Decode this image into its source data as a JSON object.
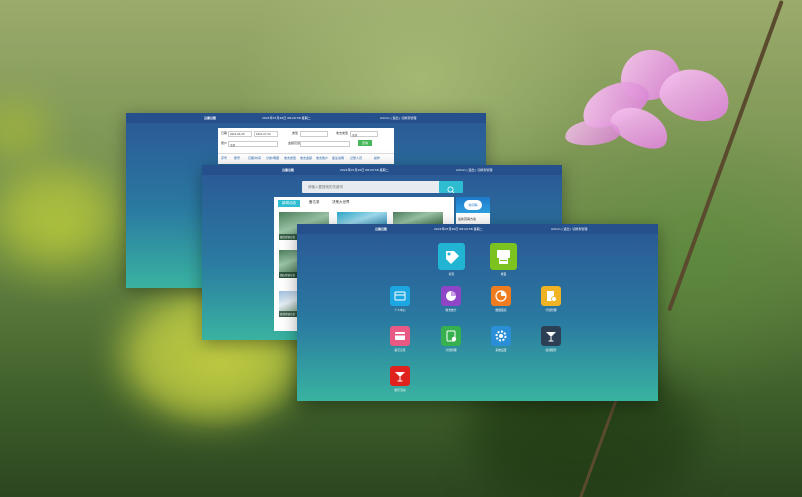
{
  "windows": {
    "w1": {
      "title": "云南记账",
      "datetime": "2021年07月20日 08:20:58 星期二",
      "user_links": "Admin | 退出 | 切换到管理",
      "form": {
        "date_label": "日期",
        "date_from": "2021-06-30",
        "date_to": "2021-07-20",
        "type_label": "类型",
        "category_label": "收支类型",
        "category_value": "全部",
        "account_label": "账户",
        "account_value": "全部",
        "amount_label": "金额范围",
        "query_button": "查询"
      },
      "nav": [
        "序号",
        "账号",
        "日期/时间",
        "分类/明细",
        "收支类型",
        "收支金额",
        "收支账户",
        "备注说明",
        "记账人员",
        "操作"
      ]
    },
    "w2": {
      "title": "云南记账",
      "datetime": "2021年07月20日 08:20:58 星期二",
      "user_links": "Admin | 退出 | 切换到管理",
      "search_placeholder": "请输入要搜索的关键词",
      "tabs": [
        "新闻动态",
        "备忘录",
        "决策大世界"
      ],
      "thumbs": [
        "微信营销方案",
        "",
        "",
        "酒店营销方案",
        "旅游营销方案"
      ],
      "side_badge": "新闻稿",
      "side_text": "最新营销方案"
    },
    "w3": {
      "title": "云南记账",
      "datetime": "2021年07月20日 08:20:58 星期二",
      "user_links": "Admin | 退出 | 切换到管理",
      "apps": [
        {
          "label": "标签",
          "color": "#22b5d3",
          "icon": "tag-icon"
        },
        {
          "label": "收银",
          "color": "#7cc31f",
          "icon": "cashier-icon"
        },
        {
          "label": "个人中心",
          "color": "#1da7e2",
          "icon": "wallet-icon"
        },
        {
          "label": "收支统计",
          "color": "#8e45c6",
          "icon": "pie-chart-icon"
        },
        {
          "label": "数据报表",
          "color": "#ef7c1f",
          "icon": "report-icon"
        },
        {
          "label": "计划管理",
          "color": "#f0b323",
          "icon": "document-settings-icon"
        },
        {
          "label": "备忘记录",
          "color": "#e85a83",
          "icon": "card-icon"
        },
        {
          "label": "计划管理",
          "color": "#36b14e",
          "icon": "calculator-icon"
        },
        {
          "label": "系统设置",
          "color": "#2a8fd6",
          "icon": "gear-icon"
        },
        {
          "label": "在线服务",
          "color": "#2d3f55",
          "icon": "cocktail-icon"
        },
        {
          "label": "娱乐活动",
          "color": "#e0221e",
          "icon": "cocktail-icon"
        }
      ]
    }
  }
}
